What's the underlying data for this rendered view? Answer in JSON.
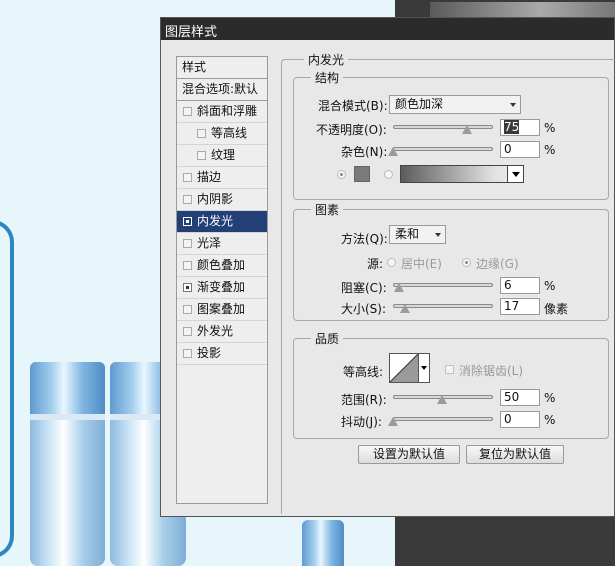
{
  "dialog": {
    "title": "图层样式"
  },
  "left_panel": {
    "header": "样式",
    "blend_options": "混合选项:默认",
    "items": [
      {
        "label": "斜面和浮雕",
        "checked": false,
        "indent": false
      },
      {
        "label": "等高线",
        "checked": false,
        "indent": true
      },
      {
        "label": "纹理",
        "checked": false,
        "indent": true
      },
      {
        "label": "描边",
        "checked": false,
        "indent": false
      },
      {
        "label": "内阴影",
        "checked": false,
        "indent": false
      },
      {
        "label": "内发光",
        "checked": true,
        "indent": false,
        "selected": true
      },
      {
        "label": "光泽",
        "checked": false,
        "indent": false
      },
      {
        "label": "颜色叠加",
        "checked": false,
        "indent": false
      },
      {
        "label": "渐变叠加",
        "checked": true,
        "indent": false
      },
      {
        "label": "图案叠加",
        "checked": false,
        "indent": false
      },
      {
        "label": "外发光",
        "checked": false,
        "indent": false
      },
      {
        "label": "投影",
        "checked": false,
        "indent": false
      }
    ]
  },
  "inner_glow": {
    "section_title": "内发光",
    "structure": {
      "title": "结构",
      "blend_mode_label": "混合模式(B):",
      "blend_mode_value": "颜色加深",
      "opacity_label": "不透明度(O):",
      "opacity_value": "75",
      "opacity_unit": "%",
      "opacity_fraction": 0.75,
      "noise_label": "杂色(N):",
      "noise_value": "0",
      "noise_unit": "%",
      "color_swatch": "#7a7a7a"
    },
    "elements": {
      "title": "图素",
      "technique_label": "方法(Q):",
      "technique_value": "柔和",
      "source_label": "源:",
      "source_center": "居中(E)",
      "source_edge": "边缘(G)",
      "choke_label": "阻塞(C):",
      "choke_value": "6",
      "choke_unit": "%",
      "size_label": "大小(S):",
      "size_value": "17",
      "size_unit": "像素"
    },
    "quality": {
      "title": "品质",
      "contour_label": "等高线:",
      "anti_alias_label": "消除锯齿(L)",
      "range_label": "范围(R):",
      "range_value": "50",
      "range_unit": "%",
      "jitter_label": "抖动(J):",
      "jitter_value": "0",
      "jitter_unit": "%"
    },
    "buttons": {
      "make_default": "设置为默认值",
      "reset_default": "复位为默认值"
    }
  }
}
